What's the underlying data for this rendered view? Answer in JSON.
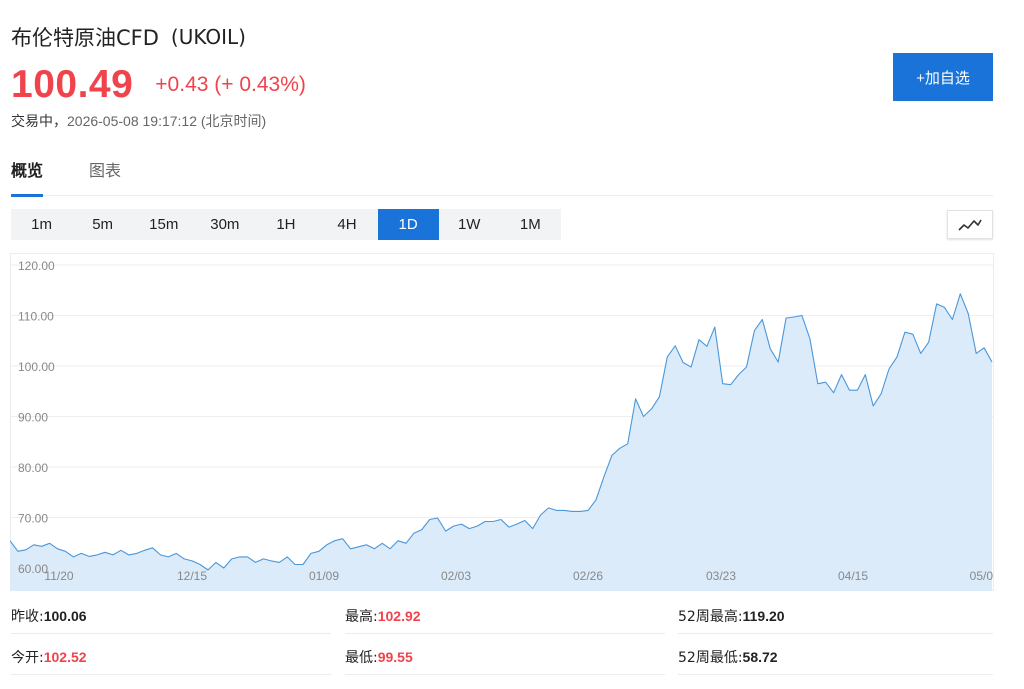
{
  "header": {
    "title": "布伦特原油CFD",
    "symbol": "(UKOIL)",
    "price": "100.49",
    "change": "+0.43 (+ 0.43%)",
    "status": "交易中，",
    "timestamp": "2026-05-08 19:17:12 (北京时间)",
    "add_button": "+加自选"
  },
  "colors": {
    "accent": "#1a73d9",
    "up": "#f0434c",
    "line": "#4a97d9",
    "fill": "#dcebfa"
  },
  "tabs": [
    {
      "label": "概览",
      "active": true
    },
    {
      "label": "图表",
      "active": false
    }
  ],
  "periods": [
    {
      "label": "1m",
      "active": false
    },
    {
      "label": "5m",
      "active": false
    },
    {
      "label": "15m",
      "active": false
    },
    {
      "label": "30m",
      "active": false
    },
    {
      "label": "1H",
      "active": false
    },
    {
      "label": "4H",
      "active": false
    },
    {
      "label": "1D",
      "active": true
    },
    {
      "label": "1W",
      "active": false
    },
    {
      "label": "1M",
      "active": false
    }
  ],
  "chart_type_icon": "line-chart-icon",
  "chart_data": {
    "type": "area",
    "ylim": [
      60,
      120
    ],
    "yticks": [
      "60.00",
      "70.00",
      "80.00",
      "90.00",
      "100.00",
      "110.00",
      "120.00"
    ],
    "xticks": [
      "11/20",
      "12/15",
      "01/09",
      "02/03",
      "02/26",
      "03/23",
      "04/15",
      "05/0"
    ],
    "grid": true,
    "values": [
      65.4,
      63.3,
      63.6,
      64.6,
      64.3,
      64.9,
      63.8,
      63.3,
      62.2,
      62.9,
      62.3,
      62.6,
      63.1,
      62.6,
      63.5,
      62.6,
      62.9,
      63.5,
      64.0,
      62.6,
      62.2,
      62.9,
      61.8,
      61.4,
      60.7,
      59.6,
      61.1,
      60.0,
      61.8,
      62.2,
      62.2,
      61.1,
      61.8,
      61.4,
      61.1,
      62.2,
      60.7,
      60.7,
      62.9,
      63.3,
      64.6,
      65.4,
      65.8,
      63.8,
      64.2,
      64.6,
      63.8,
      64.9,
      63.8,
      65.4,
      64.9,
      66.9,
      67.6,
      69.6,
      69.9,
      67.3,
      68.3,
      68.7,
      67.8,
      68.3,
      69.2,
      69.2,
      69.6,
      68.1,
      68.7,
      69.4,
      67.8,
      70.5,
      71.9,
      71.4,
      71.4,
      71.2,
      71.2,
      71.4,
      73.5,
      78.1,
      82.3,
      83.7,
      84.6,
      93.5,
      90.0,
      91.5,
      93.9,
      101.8,
      104.0,
      100.7,
      99.8,
      105.2,
      103.9,
      107.7,
      96.5,
      96.3,
      98.3,
      99.8,
      107.0,
      109.2,
      103.4,
      100.8,
      109.5,
      109.7,
      110.0,
      105.4,
      96.5,
      96.8,
      94.7,
      98.3,
      95.2,
      95.2,
      98.3,
      92.1,
      94.5,
      99.4,
      101.8,
      106.7,
      106.3,
      102.5,
      104.7,
      112.3,
      111.6,
      109.2,
      114.3,
      110.4,
      102.5,
      103.6,
      100.8
    ]
  },
  "stats": {
    "prev_close": {
      "label": "昨收:",
      "value": "100.06"
    },
    "high": {
      "label": "最高:",
      "value": "102.92"
    },
    "week52_high": {
      "label": "52周最高:",
      "value": "119.20"
    },
    "open": {
      "label": "今开:",
      "value": "102.52"
    },
    "low": {
      "label": "最低:",
      "value": "99.55"
    },
    "week52_low": {
      "label": "52周最低:",
      "value": "58.72"
    }
  }
}
